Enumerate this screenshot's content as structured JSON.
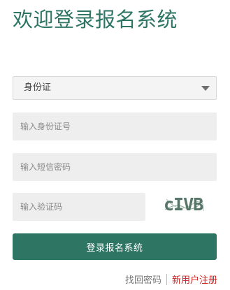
{
  "page": {
    "title": "欢迎登录报名系统"
  },
  "form": {
    "id_type": {
      "selected": "身份证"
    },
    "id_number": {
      "placeholder": "输入身份证号"
    },
    "sms_code": {
      "placeholder": "输入短信密码"
    },
    "captcha_input": {
      "placeholder": "输入验证码"
    },
    "captcha_image": {
      "text": "cIVB"
    },
    "submit_label": "登录报名系统"
  },
  "links": {
    "forgot_password": "找回密码",
    "register": "新用户注册"
  },
  "colors": {
    "brand": "#2e7564",
    "register_link": "#cc2222",
    "input_background": "#eeeeee"
  },
  "icons": {
    "select_caret": "caret-down-icon"
  }
}
